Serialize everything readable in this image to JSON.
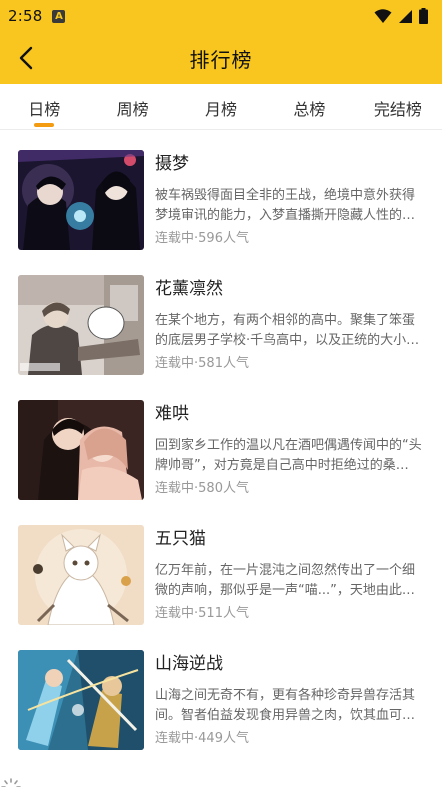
{
  "status_bar": {
    "time": "2:58",
    "notification_badge": "A",
    "icons": [
      "wifi-icon",
      "signal-icon",
      "battery-icon"
    ]
  },
  "app_bar": {
    "back_icon": "chevron-left-icon",
    "title": "排行榜"
  },
  "tabs": [
    {
      "label": "日榜",
      "active": true
    },
    {
      "label": "周榜",
      "active": false
    },
    {
      "label": "月榜",
      "active": false
    },
    {
      "label": "总榜",
      "active": false
    },
    {
      "label": "完结榜",
      "active": false
    }
  ],
  "colors": {
    "brand": "#f8c61e",
    "tab_indicator": "#f39c12"
  },
  "list": [
    {
      "title": "摄梦",
      "description": "被车祸毁得面目全非的王战，绝境中意外获得梦境审讯的能力，入梦直播撕开隐藏人性的黑暗面……",
      "status": "连载中",
      "popularity": "596人气"
    },
    {
      "title": "花薰凛然",
      "description": "在某个地方，有两个相邻的高中。聚集了笨蛋的底层男子学校·千鸟高中，以及正统的大小姐学校……",
      "status": "连载中",
      "popularity": "581人气"
    },
    {
      "title": "难哄",
      "description": "回到家乡工作的温以凡在酒吧偶遇传闻中的“头牌帅哥”，对方竟是自己高中时拒绝过的桑延……",
      "status": "连载中",
      "popularity": "580人气"
    },
    {
      "title": "五只猫",
      "description": "亿万年前，在一片混沌之间忽然传出了一个细微的声响，那似乎是一声“喵...”，天地由此而生……",
      "status": "连载中",
      "popularity": "511人气"
    },
    {
      "title": "山海逆战",
      "description": "山海之间无奇不有，更有各种珍奇异兽存活其间。智者伯益发现食用异兽之肉，饮其血可获得其能力……",
      "status": "连载中",
      "popularity": "449人气"
    }
  ],
  "loading_icon": "loading-spinner-icon"
}
